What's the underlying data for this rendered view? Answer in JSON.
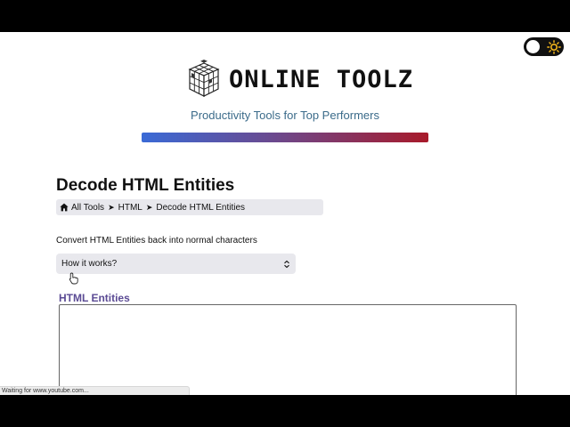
{
  "header": {
    "logo_text": "ONLINE TOOLZ",
    "tagline": "Productivity Tools for Top Performers",
    "gradient_colors": [
      "#3a6ad6",
      "#6a4a90",
      "#a81a2a"
    ]
  },
  "theme_toggle": {
    "icon": "sun-icon",
    "state": "light"
  },
  "page": {
    "title": "Decode HTML Entities",
    "breadcrumb": {
      "home_icon": "home-icon",
      "items": [
        "All Tools",
        "HTML",
        "Decode HTML Entities"
      ],
      "separator": "➤"
    },
    "description": "Convert HTML Entities back into normal characters",
    "how_it_works": "How it works?"
  },
  "input": {
    "label": "HTML Entities",
    "value": ""
  },
  "status_bar": {
    "text": "Waiting for www.youtube.com..."
  }
}
